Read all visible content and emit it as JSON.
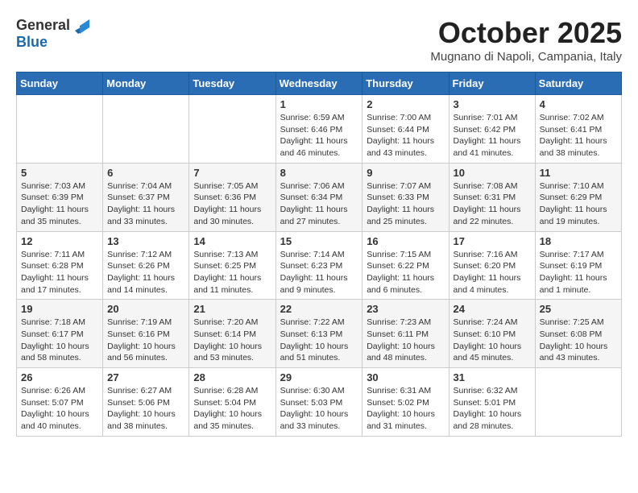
{
  "header": {
    "logo_general": "General",
    "logo_blue": "Blue",
    "month_title": "October 2025",
    "location": "Mugnano di Napoli, Campania, Italy"
  },
  "days_of_week": [
    "Sunday",
    "Monday",
    "Tuesday",
    "Wednesday",
    "Thursday",
    "Friday",
    "Saturday"
  ],
  "weeks": [
    [
      {
        "day": "",
        "info": ""
      },
      {
        "day": "",
        "info": ""
      },
      {
        "day": "",
        "info": ""
      },
      {
        "day": "1",
        "info": "Sunrise: 6:59 AM\nSunset: 6:46 PM\nDaylight: 11 hours and 46 minutes."
      },
      {
        "day": "2",
        "info": "Sunrise: 7:00 AM\nSunset: 6:44 PM\nDaylight: 11 hours and 43 minutes."
      },
      {
        "day": "3",
        "info": "Sunrise: 7:01 AM\nSunset: 6:42 PM\nDaylight: 11 hours and 41 minutes."
      },
      {
        "day": "4",
        "info": "Sunrise: 7:02 AM\nSunset: 6:41 PM\nDaylight: 11 hours and 38 minutes."
      }
    ],
    [
      {
        "day": "5",
        "info": "Sunrise: 7:03 AM\nSunset: 6:39 PM\nDaylight: 11 hours and 35 minutes."
      },
      {
        "day": "6",
        "info": "Sunrise: 7:04 AM\nSunset: 6:37 PM\nDaylight: 11 hours and 33 minutes."
      },
      {
        "day": "7",
        "info": "Sunrise: 7:05 AM\nSunset: 6:36 PM\nDaylight: 11 hours and 30 minutes."
      },
      {
        "day": "8",
        "info": "Sunrise: 7:06 AM\nSunset: 6:34 PM\nDaylight: 11 hours and 27 minutes."
      },
      {
        "day": "9",
        "info": "Sunrise: 7:07 AM\nSunset: 6:33 PM\nDaylight: 11 hours and 25 minutes."
      },
      {
        "day": "10",
        "info": "Sunrise: 7:08 AM\nSunset: 6:31 PM\nDaylight: 11 hours and 22 minutes."
      },
      {
        "day": "11",
        "info": "Sunrise: 7:10 AM\nSunset: 6:29 PM\nDaylight: 11 hours and 19 minutes."
      }
    ],
    [
      {
        "day": "12",
        "info": "Sunrise: 7:11 AM\nSunset: 6:28 PM\nDaylight: 11 hours and 17 minutes."
      },
      {
        "day": "13",
        "info": "Sunrise: 7:12 AM\nSunset: 6:26 PM\nDaylight: 11 hours and 14 minutes."
      },
      {
        "day": "14",
        "info": "Sunrise: 7:13 AM\nSunset: 6:25 PM\nDaylight: 11 hours and 11 minutes."
      },
      {
        "day": "15",
        "info": "Sunrise: 7:14 AM\nSunset: 6:23 PM\nDaylight: 11 hours and 9 minutes."
      },
      {
        "day": "16",
        "info": "Sunrise: 7:15 AM\nSunset: 6:22 PM\nDaylight: 11 hours and 6 minutes."
      },
      {
        "day": "17",
        "info": "Sunrise: 7:16 AM\nSunset: 6:20 PM\nDaylight: 11 hours and 4 minutes."
      },
      {
        "day": "18",
        "info": "Sunrise: 7:17 AM\nSunset: 6:19 PM\nDaylight: 11 hours and 1 minute."
      }
    ],
    [
      {
        "day": "19",
        "info": "Sunrise: 7:18 AM\nSunset: 6:17 PM\nDaylight: 10 hours and 58 minutes."
      },
      {
        "day": "20",
        "info": "Sunrise: 7:19 AM\nSunset: 6:16 PM\nDaylight: 10 hours and 56 minutes."
      },
      {
        "day": "21",
        "info": "Sunrise: 7:20 AM\nSunset: 6:14 PM\nDaylight: 10 hours and 53 minutes."
      },
      {
        "day": "22",
        "info": "Sunrise: 7:22 AM\nSunset: 6:13 PM\nDaylight: 10 hours and 51 minutes."
      },
      {
        "day": "23",
        "info": "Sunrise: 7:23 AM\nSunset: 6:11 PM\nDaylight: 10 hours and 48 minutes."
      },
      {
        "day": "24",
        "info": "Sunrise: 7:24 AM\nSunset: 6:10 PM\nDaylight: 10 hours and 45 minutes."
      },
      {
        "day": "25",
        "info": "Sunrise: 7:25 AM\nSunset: 6:08 PM\nDaylight: 10 hours and 43 minutes."
      }
    ],
    [
      {
        "day": "26",
        "info": "Sunrise: 6:26 AM\nSunset: 5:07 PM\nDaylight: 10 hours and 40 minutes."
      },
      {
        "day": "27",
        "info": "Sunrise: 6:27 AM\nSunset: 5:06 PM\nDaylight: 10 hours and 38 minutes."
      },
      {
        "day": "28",
        "info": "Sunrise: 6:28 AM\nSunset: 5:04 PM\nDaylight: 10 hours and 35 minutes."
      },
      {
        "day": "29",
        "info": "Sunrise: 6:30 AM\nSunset: 5:03 PM\nDaylight: 10 hours and 33 minutes."
      },
      {
        "day": "30",
        "info": "Sunrise: 6:31 AM\nSunset: 5:02 PM\nDaylight: 10 hours and 31 minutes."
      },
      {
        "day": "31",
        "info": "Sunrise: 6:32 AM\nSunset: 5:01 PM\nDaylight: 10 hours and 28 minutes."
      },
      {
        "day": "",
        "info": ""
      }
    ]
  ]
}
